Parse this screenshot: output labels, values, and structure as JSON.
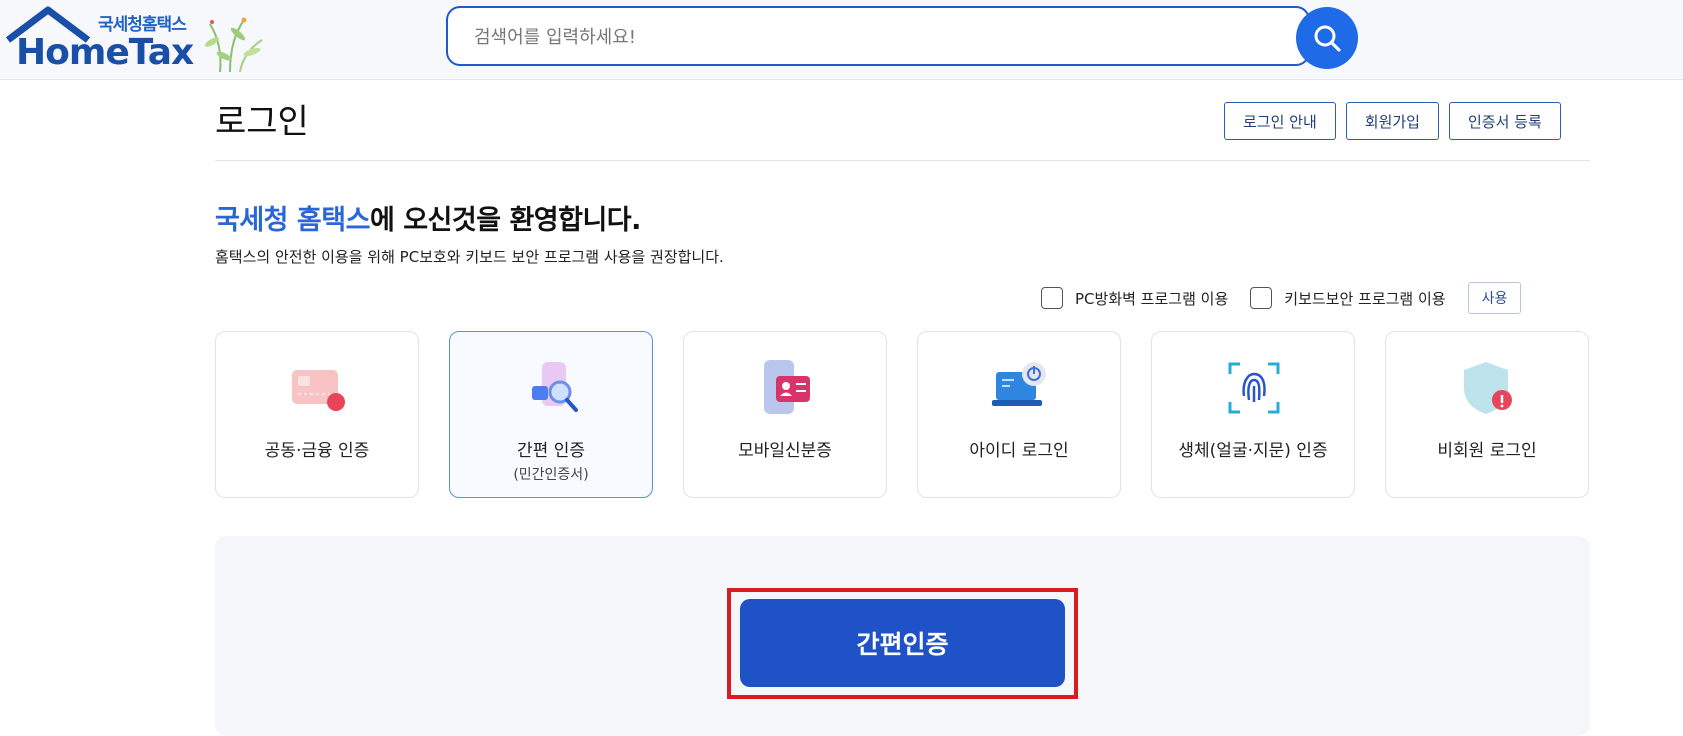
{
  "header": {
    "logo_kr": "국세청홈택스",
    "logo_en": "HomeTax",
    "search_placeholder": "검색어를 입력하세요!"
  },
  "page": {
    "title": "로그인",
    "top_buttons": [
      "로그인 안내",
      "회원가입",
      "인증서 등록"
    ]
  },
  "welcome": {
    "highlight": "국세청 홈택스",
    "rest": "에 오신것을 환영합니다.",
    "subtext": "홈택스의 안전한 이용을 위해 PC보호와 키보드 보안 프로그램 사용을 권장합니다."
  },
  "options": {
    "firewall_label": "PC방화벽 프로그램 이용",
    "keyboard_label": "키보드보안 프로그램 이용",
    "use_button": "사용"
  },
  "login_methods": [
    {
      "label": "공동·금융 인증",
      "sub": "",
      "icon": "certificate-card-icon"
    },
    {
      "label": "간편 인증",
      "sub": "(민간인증서)",
      "icon": "simple-auth-icon",
      "active": true
    },
    {
      "label": "모바일신분증",
      "sub": "",
      "icon": "mobile-id-icon"
    },
    {
      "label": "아이디 로그인",
      "sub": "",
      "icon": "id-login-laptop-icon"
    },
    {
      "label": "생체(얼굴·지문) 인증",
      "sub": "",
      "icon": "fingerprint-icon"
    },
    {
      "label": "비회원 로그인",
      "sub": "",
      "icon": "shield-guest-icon"
    }
  ],
  "main_action": {
    "label": "간편인증"
  },
  "colors": {
    "brand_blue": "#1f52c6",
    "highlight_red": "#d81d22",
    "accent_text": "#2b66d9"
  }
}
